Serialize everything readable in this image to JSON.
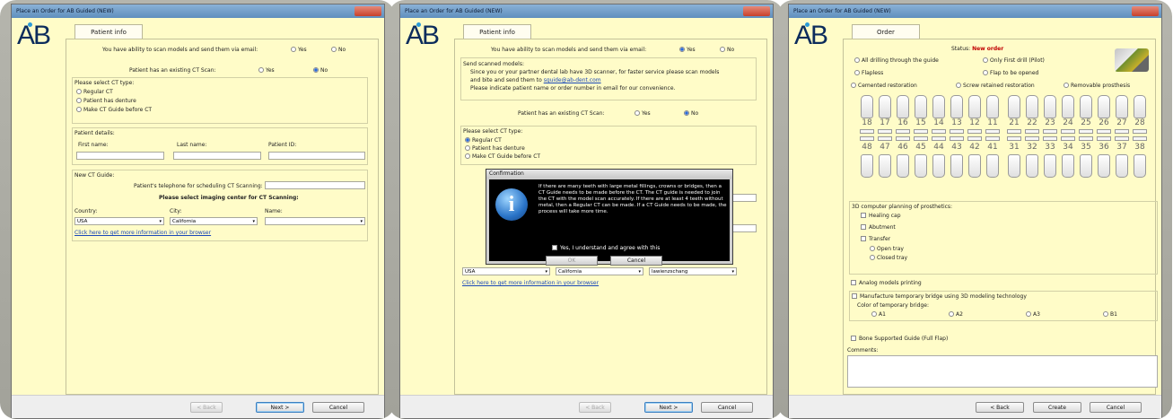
{
  "brand": {
    "logo_text": "AB",
    "logo_color": "#0c2c5c",
    "accent": "#2a9ad8"
  },
  "win1": {
    "title": "Place an Order for AB Guided (NEW)",
    "tab": "Patient info",
    "scan_q": "You have ability to scan models and send them via email:",
    "yes": "Yes",
    "no": "No",
    "ct_q": "Patient has an existing CT Scan:",
    "ct_type_header": "Please select CT type:",
    "ct_options": [
      "Regular CT",
      "Patient has denture",
      "Make CT Guide before CT"
    ],
    "details_header": "Patient details:",
    "first_name": "First name:",
    "last_name": "Last name:",
    "patient_id": "Patient ID:",
    "guide_header": "New CT Guide:",
    "phone_label": "Patient's telephone for scheduling CT Scanning:",
    "imaging_title": "Please select imaging center for CT Scanning:",
    "country_label": "Country:",
    "city_label": "City:",
    "name_label": "Name:",
    "country_value": "USA",
    "city_value": "California",
    "name_value": "",
    "link": "Click here to get more information in your browser",
    "back": "< Back",
    "next": "Next >",
    "cancel": "Cancel"
  },
  "win2": {
    "title": "Place an Order for AB Guided (NEW)",
    "tab": "Patient info",
    "scan_q": "You have ability to scan models and send them via email:",
    "yes": "Yes",
    "no": "No",
    "send_header": "Send scanned models:",
    "send_line1": "Since you or your partner dental lab have 3D scanner, for faster service please scan models",
    "send_line2_a": "and bite and send them to ",
    "send_email": "sguide@ab-dent.com",
    "send_line3": "Please indicate patient name or order number in email for our convenience.",
    "ct_q": "Patient has an existing CT Scan:",
    "ct_type_header": "Please select CT type:",
    "ct_options": [
      "Regular CT",
      "Patient has denture",
      "Make CT Guide before CT"
    ],
    "dialog_title": "Confirmation",
    "dialog_text": "If there are many teeth with large metal fillings, crowns or bridges, then a CT Guide needs to be made before the CT. The CT guide is needed to join the CT with the model scan accurately. If there are at least 4 teeth without metal, then a Regular CT can be made. If a CT Guide needs to be made, the process will take more time.",
    "dialog_check": "Yes, I understand and agree with this",
    "dialog_ok": "OK",
    "dialog_cancel": "Cancel",
    "country_value": "USA",
    "city_value": "California",
    "name_value": "lawienzschang",
    "link": "Click here to get more information in your browser",
    "back": "< Back",
    "next": "Next >",
    "cancel": "Cancel"
  },
  "win3": {
    "title": "Place an Order for AB Guided (NEW)",
    "tab": "Order",
    "status_label": "Status:",
    "status_value": "New order",
    "status_color": "#c00000",
    "drill_opts": [
      "All drilling through the guide",
      "Only First drill (Pilot)"
    ],
    "flap_opts": [
      "Flapless",
      "Flap to be opened"
    ],
    "resto_opts": [
      "Cemented restoration",
      "Screw retained restoration",
      "Removable prosthesis"
    ],
    "upper_teeth": [
      "18",
      "17",
      "16",
      "15",
      "14",
      "13",
      "12",
      "11",
      "21",
      "22",
      "23",
      "24",
      "25",
      "26",
      "27",
      "28"
    ],
    "lower_teeth": [
      "48",
      "47",
      "46",
      "45",
      "44",
      "43",
      "42",
      "41",
      "31",
      "32",
      "33",
      "34",
      "35",
      "36",
      "37",
      "38"
    ],
    "planning_header": "3D computer planning of prosthetics:",
    "planning_items": [
      "Healing cap",
      "Abutment",
      "Transfer"
    ],
    "tray_opts": [
      "Open tray",
      "Closed tray"
    ],
    "analog": "Analog models printing",
    "manufacture": "Manufacture temporary bridge using 3D modeling technology",
    "color_label": "Color of temporary bridge:",
    "color_opts": [
      "A1",
      "A2",
      "A3",
      "B1"
    ],
    "bone": "Bone Supported Guide (Full Flap)",
    "comments": "Comments:",
    "back": "< Back",
    "create": "Create",
    "cancel": "Cancel"
  }
}
